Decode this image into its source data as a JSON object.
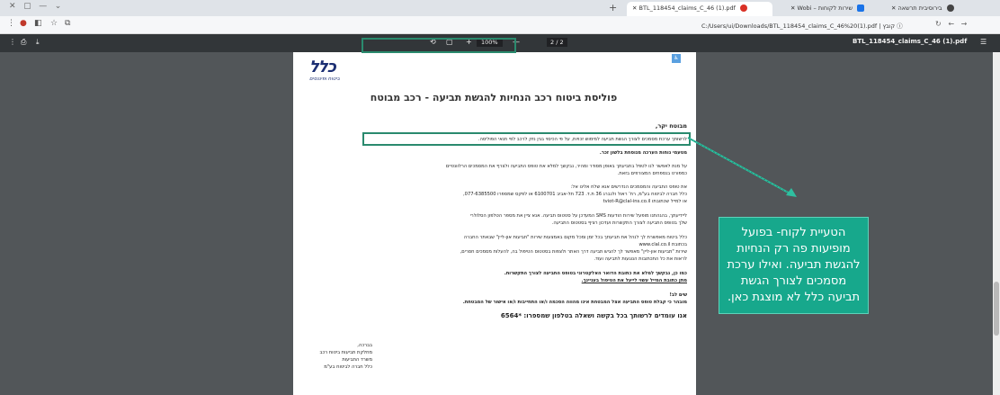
{
  "browser": {
    "tabs": [
      {
        "label": "BTL_118454_claims_C_46 (1).pdf",
        "active": true
      },
      {
        "label": "Wobi – שירות לקוחות"
      },
      {
        "label": "בירוסיבית תרשאה"
      }
    ],
    "address": "C:/Users/ui/Downloads/BTL_118454_claims_C_46%20(1).pdf",
    "address_prefix": "קובץ"
  },
  "pdf_toolbar": {
    "zoom": "100%",
    "page_current": "2",
    "page_total": "2",
    "filename": "BTL_118454_claims_C_46 (1).pdf"
  },
  "document": {
    "logo_text": "כלל",
    "logo_sub": "ביטוח ופיננסים",
    "title": "פוליסת ביטוח רכב הנחיות להגשת תביעה - רכב מבוטח",
    "subtitle": "מבוטח יקר,",
    "lines": [
      "לרשותך ערכת מסמכים לצורך הגשת תביעה למימוש זכויות, על פי הכיסוי בגין נזק לרכב לפי תנאי הפוליסה.",
      "מטעמי נוחות הערכה מנוסחת בלשון זכר.",
      "על מנת לאפשר לנו לטפל בתביעתך באופן מסודר ומהיר, נבקשך למלא את טופס התביעה ולצרף את המסמכים הרלוונטיים",
      "כמפורט בנספחים המצורפים בזאת.",
      "את טופס התביעה והמסמכים הנדרשים אנא שלח אלינו אל:",
      "כלל חברה לביטוח בע\"מ, רח' ראול ולנברג 36 ת.ד. 723 תל-אביב 6100701 או לפקס שמספרו 077-6385500,",
      "או למייל שכתובתו tviot-R@clal-ins.co.il",
      "ליידיעתך, בהגהתנו מופעל שירות הודעות SMS המעדכן על סטטוס תביעה. אנא ציין את מספר הטלפון הסלולרי",
      "שלך בטופס התביעה לצורך התקשרות ועדכון רציף בסטטוס התביעה.",
      "כלל ביטוח מאפשרת לך לנהל את תביעתך בכל זמן ומכל מקום באמצעות שירות \"תביעות און-ליין\" שבאתר החברה",
      "בכתובת www.clal.co.il",
      "שירות \"תביעות און-ליין\" מאפשר לך להגיש תביעה דרך האתר ולצפות בסטטוס הטיפול בה, להעלות מסמכים חסרים,",
      "לראות את כל התכתובות הנוגעות לתביעה ועוד.",
      "כמו כן, נבקשך למלא את כתובת הדואר האלקטרוני בטופס התביעה לצורך התקשרות.",
      "מתן כתובת המייל עשוי לייעל את הטיפול בעניינך.",
      "שים לב!",
      "מובהר כי קבלת טופס התביעה אצל המבטחת אינו מהווה הסכמה ו/או התחייבות ו/או אישור של המבטחת.",
      "אנו עומדים לרשותך בכל בקשה ושאלה בטלפון שמספרו: *6564",
      "בברכה,",
      "מחלקת תביעות ביטוח רכב",
      "משרד התביעות",
      "כלל חברה לביטוח בע\"מ"
    ]
  },
  "callout": {
    "text": "הטעיית לקוח- בפועל מופיעות פה רק הנחיות להגשת תביעה. ואילו ערכת מסמכים לצורך הגשת תביעה כלל לא מוצגת כאן."
  }
}
